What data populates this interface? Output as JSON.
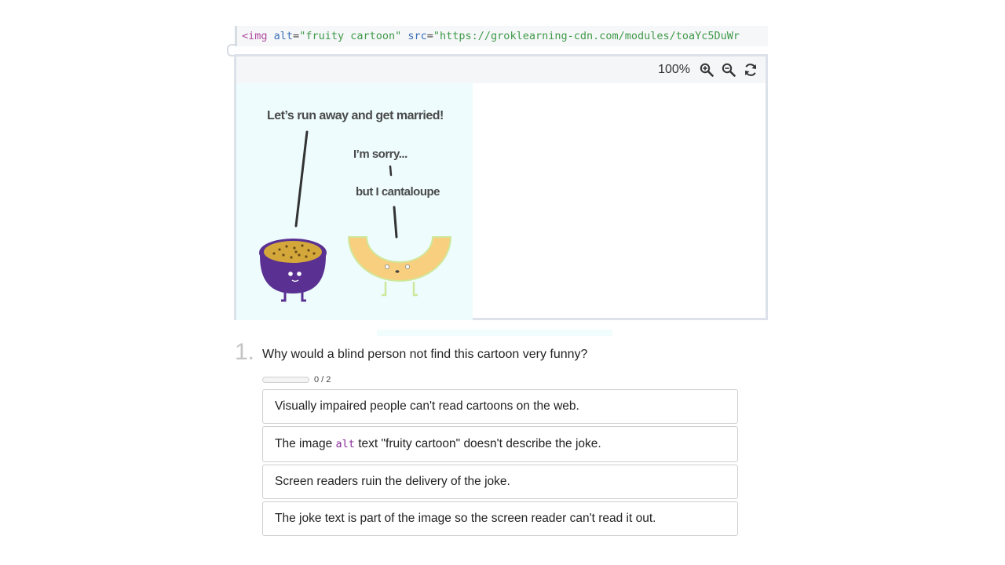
{
  "code": {
    "tag_open": "<img",
    "attr1": "alt",
    "eq1": "=",
    "val1": "\"fruity cartoon\"",
    "attr2": "src",
    "eq2": "=",
    "val2": "\"https://groklearning-cdn.com/modules/toaYc5DuWr"
  },
  "preview": {
    "zoom_level": "100%",
    "icons": [
      "zoom-in-icon",
      "zoom-out-icon",
      "refresh-icon"
    ],
    "cartoon": {
      "caption1": "Let’s run away and get married!",
      "caption2": "I’m sorry...",
      "caption3": "but I cantaloupe"
    }
  },
  "question": {
    "number": "1.",
    "text": "Why would a blind person not find this cartoon very funny?",
    "progress_text": "0 / 2",
    "progress_fraction": 0,
    "options": [
      {
        "text": "Visually impaired people can't read cartoons on the web."
      },
      {
        "before": "The image ",
        "code": "alt",
        "after": " text \"fruity cartoon\" doesn't describe the joke."
      },
      {
        "text": "Screen readers ruin the delivery of the joke."
      },
      {
        "text": "The joke text is part of the image so the screen reader can't read it out."
      }
    ]
  },
  "colors": {
    "code_tag": "#b04a9e",
    "code_attr": "#3b6fb6",
    "code_string": "#3f9a49",
    "inline_code": "#8a2d9b",
    "cartoon_bg": "#eefcfd",
    "passionfruit": "#5a3192",
    "cantaloupe": "#f8cf7e"
  }
}
